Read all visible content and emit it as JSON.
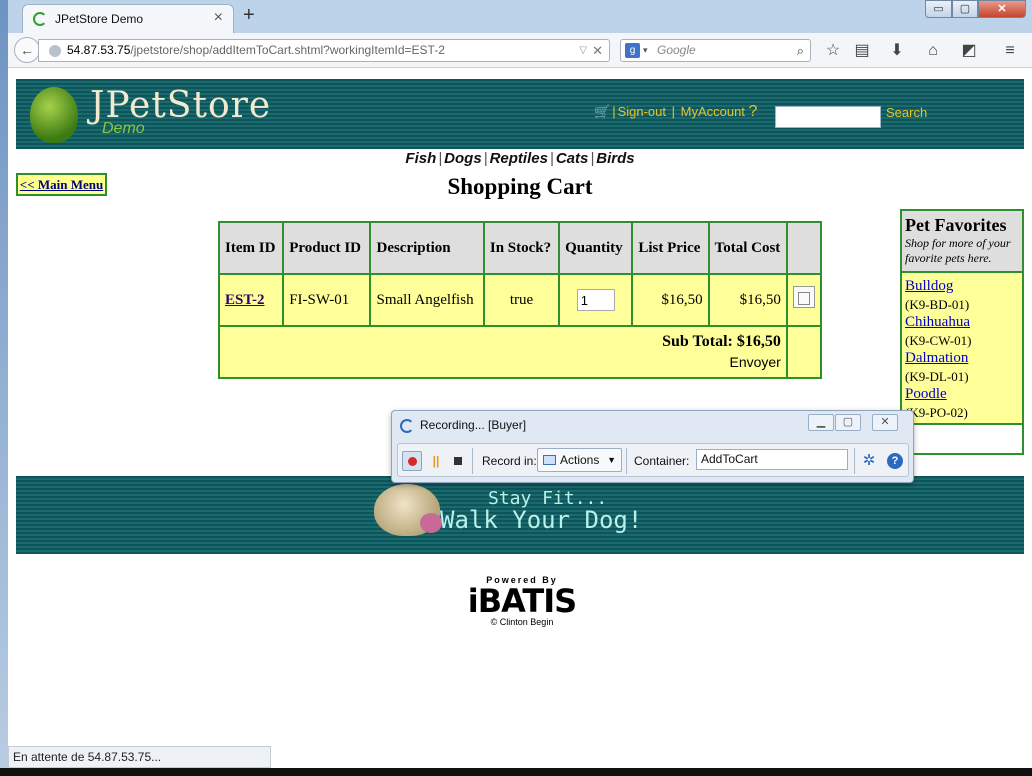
{
  "browser": {
    "tab_title": "JPetStore Demo",
    "tab_close": "×",
    "new_tab": "+",
    "url_host": "54.87.53.75",
    "url_path": "/jpetstore/shop/addItemToCart.shtml?workingItemId=EST-2",
    "search_engine_letter": "g",
    "search_placeholder": "Google",
    "window_min": "▭",
    "window_max": "▢",
    "window_close": "✕"
  },
  "header": {
    "logo_title": "JPetStore",
    "logo_sub": "Demo",
    "cart_icon": "cart-icon",
    "signout": "Sign-out",
    "my_account": "MyAccount",
    "help": "?",
    "search_button": "Search"
  },
  "categories": [
    "Fish",
    "Dogs",
    "Reptiles",
    "Cats",
    "Birds"
  ],
  "main_menu": "<< Main Menu",
  "cart": {
    "title": "Shopping Cart",
    "headers": [
      "Item ID",
      "Product ID",
      "Description",
      "In Stock?",
      "Quantity",
      "List Price",
      "Total Cost",
      ""
    ],
    "rows": [
      {
        "item_id": "EST-2",
        "product_id": "FI-SW-01",
        "description": "Small Angelfish",
        "in_stock": "true",
        "quantity": "1",
        "list_price": "$16,50",
        "total_cost": "$16,50"
      }
    ],
    "subtotal_label": "Sub Total: $16,50",
    "submit_label": "Envoyer"
  },
  "favorites": {
    "title": "Pet Favorites",
    "subtitle": "Shop for more of your favorite pets here.",
    "items": [
      {
        "name": "Bulldog",
        "code": "(K9-BD-01)"
      },
      {
        "name": "Chihuahua",
        "code": "(K9-CW-01)"
      },
      {
        "name": "Dalmation",
        "code": "(K9-DL-01)"
      },
      {
        "name": "Poodle",
        "code": "(K9-PO-02)"
      }
    ]
  },
  "footer": {
    "line1": "Stay Fit...",
    "line2": "Walk Your Dog!"
  },
  "ibatis": {
    "powered": "Powered By",
    "brand": "iBATIS",
    "credit": "© Clinton Begin"
  },
  "recorder": {
    "title": "Recording... [Buyer]",
    "record_in_label": "Record in:",
    "record_in_value": "Actions",
    "container_label": "Container:",
    "container_value": "AddToCart",
    "help": "?"
  },
  "status_text": "En attente de 54.87.53.75..."
}
